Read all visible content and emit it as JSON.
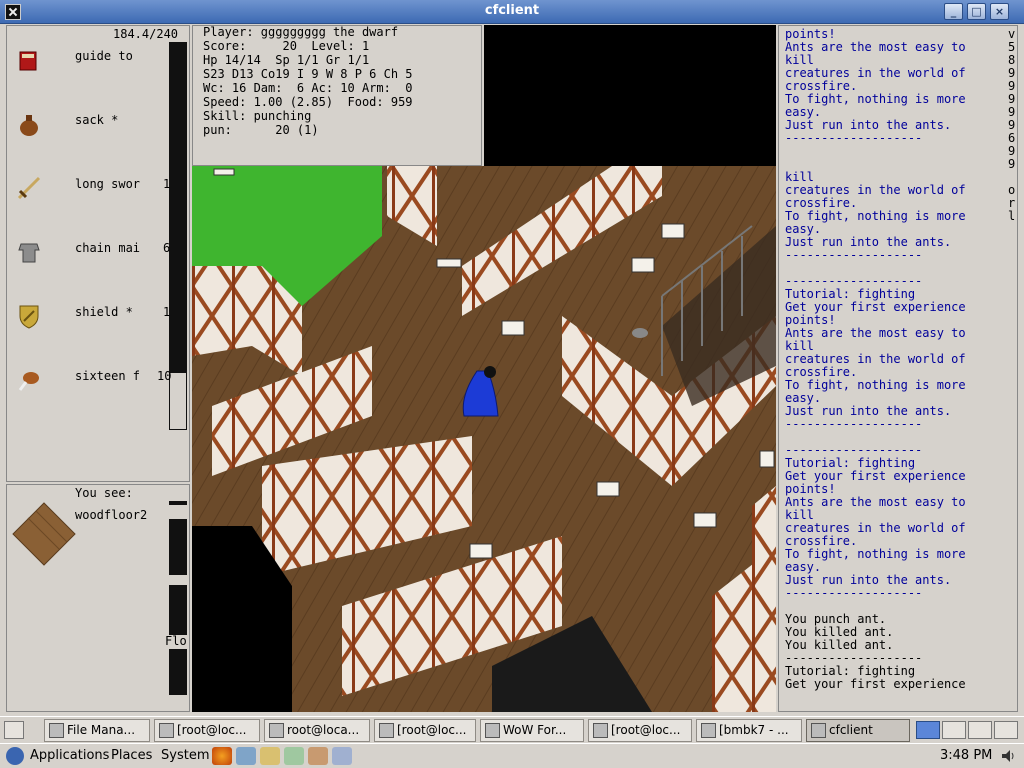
{
  "window": {
    "title": "cfclient"
  },
  "inventory": {
    "weight": "184.4/240",
    "items": [
      {
        "name": "guide to",
        "icon": "book-icon",
        "extra": ""
      },
      {
        "name": "sack *",
        "icon": "sack-icon",
        "extra": ""
      },
      {
        "name": "long swor",
        "icon": "sword-icon",
        "extra": "1"
      },
      {
        "name": "chain mai",
        "icon": "chainmail-icon",
        "extra": "6"
      },
      {
        "name": "shield *",
        "icon": "shield-icon",
        "extra": "1"
      },
      {
        "name": "sixteen f",
        "icon": "food-icon",
        "extra": "10"
      }
    ]
  },
  "look": {
    "header": "You see:",
    "item": "woodfloor2",
    "side_label": "Flo"
  },
  "stats": {
    "lines": [
      "Player: ggggggggg the dwarf",
      "Score:     20  Level: 1",
      "Hp 14/14  Sp 1/1 Gr 1/1",
      "S23 D13 Co19 I 9 W 8 P 6 Ch 5",
      "Wc: 16 Dam:  6 Ac: 10 Arm:  0",
      "Speed: 1.00 (2.85)  Food: 959",
      "Skill: punching",
      "pun:      20 (1)"
    ]
  },
  "messages": {
    "lines": [
      "points!",
      "Ants are the most easy to",
      "kill",
      "creatures in the world of",
      "crossfire.",
      "To fight, nothing is more",
      "easy.",
      "Just run into the ants.",
      "-------------------",
      "",
      "",
      "kill",
      "creatures in the world of",
      "crossfire.",
      "To fight, nothing is more",
      "easy.",
      "Just run into the ants.",
      "-------------------",
      "",
      "-------------------",
      "Tutorial: fighting",
      "Get your first experience",
      "points!",
      "Ants are the most easy to",
      "kill",
      "creatures in the world of",
      "crossfire.",
      "To fight, nothing is more",
      "easy.",
      "Just run into the ants.",
      "-------------------",
      "",
      "-------------------",
      "Tutorial: fighting",
      "Get your first experience",
      "points!",
      "Ants are the most easy to",
      "kill",
      "creatures in the world of",
      "crossfire.",
      "To fight, nothing is more",
      "easy.",
      "Just run into the ants.",
      "-------------------",
      "",
      "You punch ant.",
      "You killed ant.",
      "You killed ant.",
      "-------------------",
      "Tutorial: fighting",
      "Get your first experience"
    ],
    "black_from": 45,
    "edge_chars": [
      "v",
      "5",
      "8",
      "9",
      "9",
      "9",
      "9",
      "9",
      "6",
      "9",
      "9",
      "",
      "o",
      "r",
      "l"
    ]
  },
  "taskbar": {
    "tasks": [
      {
        "label": "File Mana...",
        "icon": "folder-icon"
      },
      {
        "label": "[root@loc...",
        "icon": "terminal-icon"
      },
      {
        "label": "root@loca...",
        "icon": "terminal-icon"
      },
      {
        "label": "[root@loc...",
        "icon": "terminal-icon"
      },
      {
        "label": "WoW For...",
        "icon": "firefox-icon"
      },
      {
        "label": "[root@loc...",
        "icon": "terminal-icon"
      },
      {
        "label": "[bmbk7 - ...",
        "icon": "editor-icon"
      },
      {
        "label": "cfclient",
        "icon": "cfclient-icon"
      }
    ]
  },
  "panel": {
    "menus": [
      "Applications",
      "Places",
      "System"
    ],
    "clock": "3:48 PM"
  },
  "colors": {
    "title_bar": "#3d6ab3",
    "message_text": "#00009a",
    "grass": "#3fb52f",
    "wood_floor": "#6b4a2a"
  }
}
